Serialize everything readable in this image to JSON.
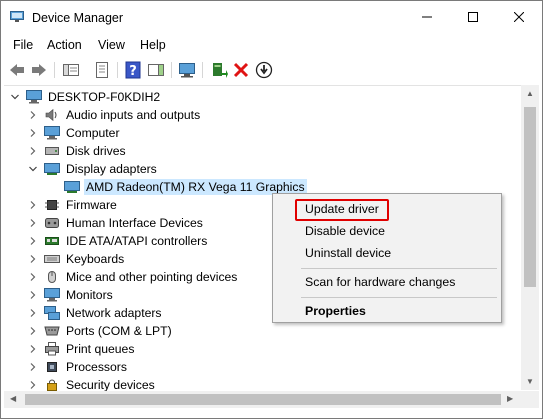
{
  "window": {
    "title": "Device Manager",
    "controls": {
      "minimize": "minimize",
      "maximize": "maximize",
      "close": "close"
    }
  },
  "menu": [
    "File",
    "Action",
    "View",
    "Help"
  ],
  "toolbar": {
    "buttons": [
      "back-icon",
      "forward-icon",
      "show-hide-console-tree-icon",
      "properties-icon",
      "help-icon",
      "action-pane-icon",
      "scan-hardware-icon",
      "update-driver-icon",
      "uninstall-icon",
      "disable-icon"
    ]
  },
  "tree": {
    "root": "DESKTOP-F0KDIH2",
    "categories": [
      "Audio inputs and outputs",
      "Computer",
      "Disk drives",
      "Display adapters",
      "Firmware",
      "Human Interface Devices",
      "IDE ATA/ATAPI controllers",
      "Keyboards",
      "Mice and other pointing devices",
      "Monitors",
      "Network adapters",
      "Ports (COM & LPT)",
      "Print queues",
      "Processors",
      "Security devices"
    ],
    "expanded_category": "Display adapters",
    "expanded_child": "AMD Radeon(TM) RX Vega 11 Graphics"
  },
  "context_menu": {
    "update": "Update driver",
    "disable": "Disable device",
    "uninstall": "Uninstall device",
    "scan": "Scan for hardware changes",
    "properties": "Properties",
    "highlight_color": "#e00000"
  },
  "colors": {
    "selection": "#cce8ff",
    "menu_bg": "#f2f2f2"
  }
}
